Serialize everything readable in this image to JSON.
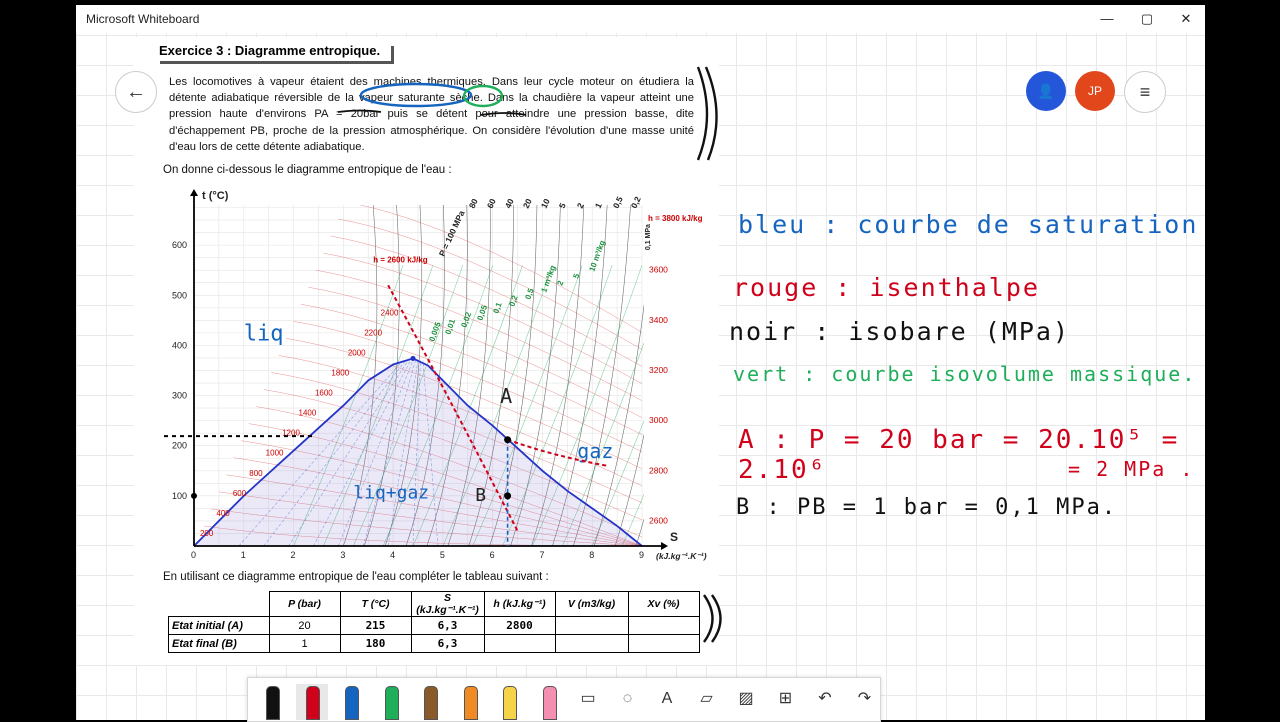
{
  "window": {
    "title": "Microsoft Whiteboard",
    "minimize": "—",
    "maximize": "▢",
    "close": "✕"
  },
  "avatar": {
    "initials": "JP"
  },
  "document": {
    "title": "Exercice 3 : Diagramme entropique.",
    "paragraph": "Les locomotives à vapeur étaient des machines thermiques. Dans leur cycle moteur on étudiera la détente adiabatique réversible de la vapeur saturante sèche. Dans la chaudière la vapeur atteint une pression haute d'environs PA = 20bar puis se détent pour atteindre une pression basse, dite d'échappement PB, proche de la pression atmosphérique. On considère l'évolution d'une masse unité d'eau lors de cette détente adiabatique.",
    "intro": "On donne ci-dessous le diagramme entropique de l'eau :",
    "question": "En utilisant ce diagramme entropique de l'eau compléter le tableau suivant :"
  },
  "chart_data": {
    "type": "line",
    "ylabel": "t (°C)",
    "xlabel": "S",
    "xunit": "(kJ.kg⁻¹.K⁻¹)",
    "x_ticks": [
      "0",
      "1",
      "2",
      "3",
      "4",
      "5",
      "6",
      "7",
      "8",
      "9"
    ],
    "y_ticks": [
      "100",
      "200",
      "300",
      "400",
      "500",
      "600"
    ],
    "xlim": [
      0,
      9
    ],
    "ylim": [
      0,
      680
    ],
    "saturation_curve": {
      "x": [
        0,
        1,
        2,
        3,
        3.5,
        4,
        4.4,
        4.7,
        5,
        5.5,
        6,
        6.5,
        7,
        7.5,
        8,
        8.5,
        9
      ],
      "y": [
        0,
        100,
        190,
        280,
        330,
        362,
        374,
        360,
        330,
        280,
        240,
        195,
        150,
        110,
        75,
        40,
        0
      ]
    },
    "enthalpy_labels_left": [
      "200",
      "400",
      "600",
      "800",
      "1000",
      "1200",
      "1400",
      "1600",
      "1800",
      "2000",
      "2200",
      "2400"
    ],
    "enthalpy_label_top": "h = 2600 kJ/kg",
    "enthalpy_labels_right": [
      "2600",
      "2800",
      "3000",
      "3200",
      "3400",
      "3600"
    ],
    "enthalpy_label_right_top": "h = 3800 kJ/kg",
    "pressure_labels_top": [
      "P = 100 MPa",
      "80",
      "60",
      "40",
      "20",
      "10",
      "5",
      "2",
      "1",
      "0,5",
      "0,2"
    ],
    "pressure_label_right": "0,1 MPa",
    "volume_labels": [
      "0,005",
      "0,01",
      "0,02",
      "0,05",
      "0,1",
      "0,2",
      "0,5",
      "1 m³/kg",
      "2",
      "5",
      "10 m³/kg"
    ],
    "annotations": [
      "liq",
      "liq+gaz",
      "gaz",
      "A",
      "B"
    ],
    "points": [
      {
        "name": "A",
        "x": 6.3,
        "y": 212
      },
      {
        "name": "B",
        "x": 6.3,
        "y": 100
      }
    ]
  },
  "table": {
    "headers": [
      "",
      "P (bar)",
      "T (°C)",
      "S (kJ.kg⁻¹.K⁻¹)",
      "h (kJ.kg⁻¹)",
      "V (m3/kg)",
      "Xv (%)"
    ],
    "rows": [
      {
        "label": "Etat initial (A)",
        "values": [
          "20",
          "215",
          "6,3",
          "2800",
          "",
          ""
        ]
      },
      {
        "label": "Etat final (B)",
        "values": [
          "1",
          "180",
          "6,3",
          "",
          "",
          ""
        ]
      }
    ]
  },
  "notes": {
    "blue": "bleu : courbe de saturation",
    "red": "rouge : isenthalpe",
    "black": "noir : isobare (MPa)",
    "green": "vert : courbe isovolume massique.",
    "a_line1": "A :  P = 20 bar = 20.10⁵ = 2.10⁶",
    "a_line2": "= 2 MPa .",
    "b_line": "B : PB = 1 bar = 0,1 MPa."
  },
  "colors": {
    "blue": "#1565c0",
    "red": "#d0021b",
    "green": "#1fae5a",
    "black": "#111111",
    "avatar": "#e2471c",
    "accent": "#2356d8"
  },
  "toolbar": [
    "pen-black",
    "pen-red",
    "pen-blue",
    "pen-green",
    "pen-brown",
    "pen-orange",
    "highlighter-yellow",
    "highlighter-pink",
    "ruler",
    "lasso",
    "text",
    "sticky-note",
    "image",
    "add",
    "undo",
    "redo"
  ]
}
